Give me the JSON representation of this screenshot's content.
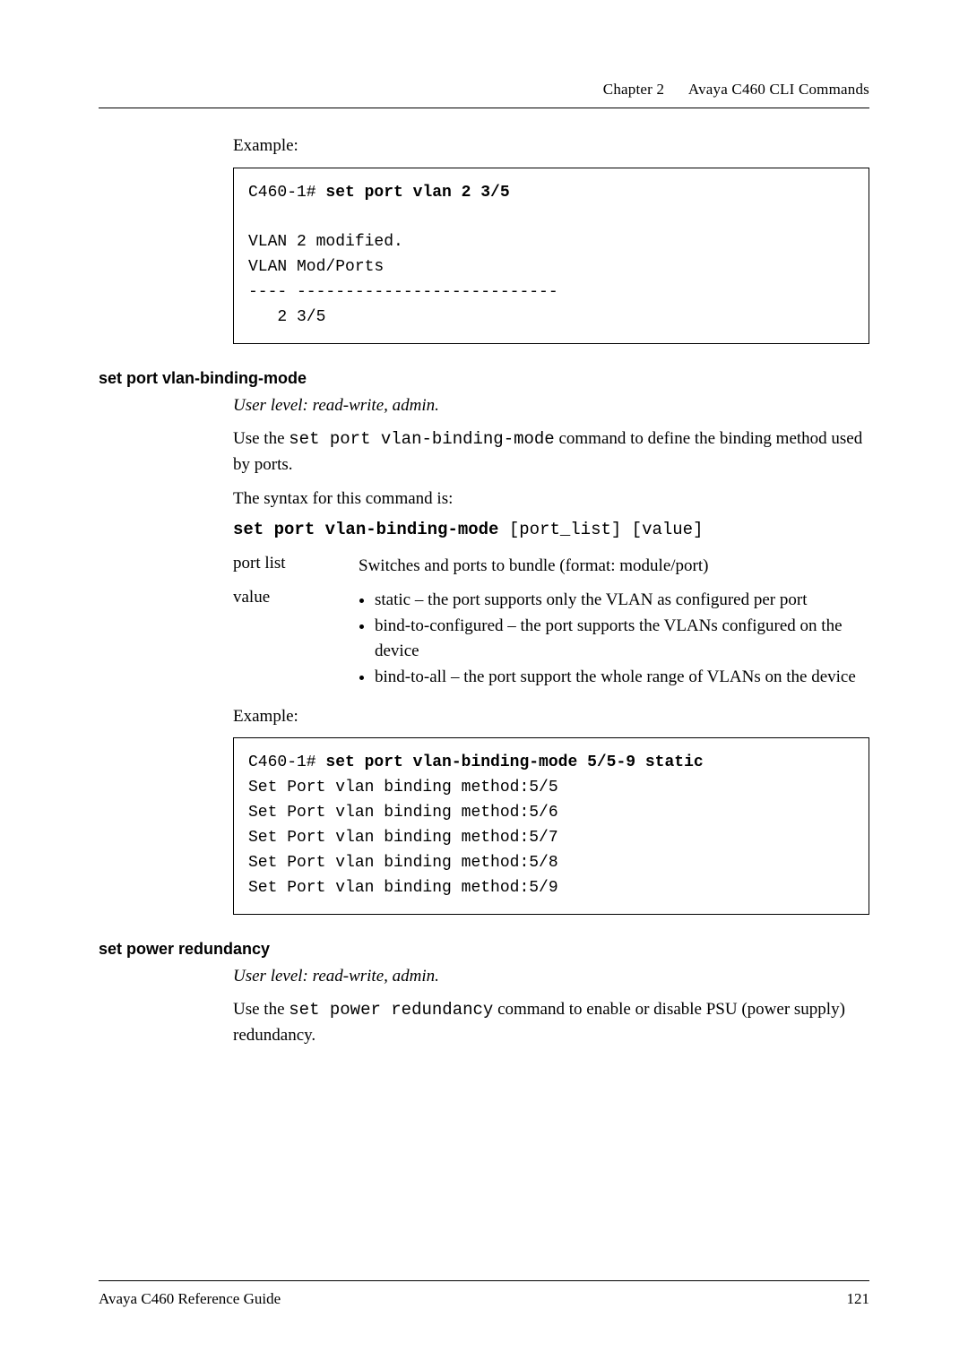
{
  "header": {
    "chapter": "Chapter 2",
    "title": "Avaya C460 CLI Commands"
  },
  "sec1": {
    "example_label": "Example:",
    "code": "C460-1# set port vlan 2 3/5\n\nVLAN 2 modified.\nVLAN Mod/Ports\n---- ---------------------------\n   2 3/5"
  },
  "sec2": {
    "heading": "set port vlan-binding-mode",
    "userlevel": "User level: read-write, admin.",
    "desc_pre": "Use the ",
    "desc_cmd": "set port vlan-binding-mode",
    "desc_post": " command to define the binding method used by ports.",
    "syntax_label": "The syntax for this command is:",
    "syntax_bold": "set port vlan-binding-mode",
    "syntax_args": " [port_list] [value]",
    "params": {
      "portlist": {
        "name": "port list",
        "desc": "Switches and ports to bundle (format: module/port)"
      },
      "value": {
        "name": "value",
        "b1": "static – the port supports only the VLAN as configured per port",
        "b2": "bind-to-configured – the port supports the VLANs configured on the device",
        "b3": "bind-to-all – the port support the whole range of VLANs on the device"
      }
    },
    "example_label": "Example:",
    "code": "C460-1# set port vlan-binding-mode 5/5-9 static\nSet Port vlan binding method:5/5\nSet Port vlan binding method:5/6\nSet Port vlan binding method:5/7\nSet Port vlan binding method:5/8\nSet Port vlan binding method:5/9"
  },
  "sec3": {
    "heading": "set power redundancy",
    "userlevel": "User level: read-write, admin.",
    "desc_pre": "Use the ",
    "desc_cmd": "set power redundancy",
    "desc_post": " command to enable or disable PSU (power supply) redundancy."
  },
  "footer": {
    "left": "Avaya C460 Reference Guide",
    "right": "121"
  }
}
